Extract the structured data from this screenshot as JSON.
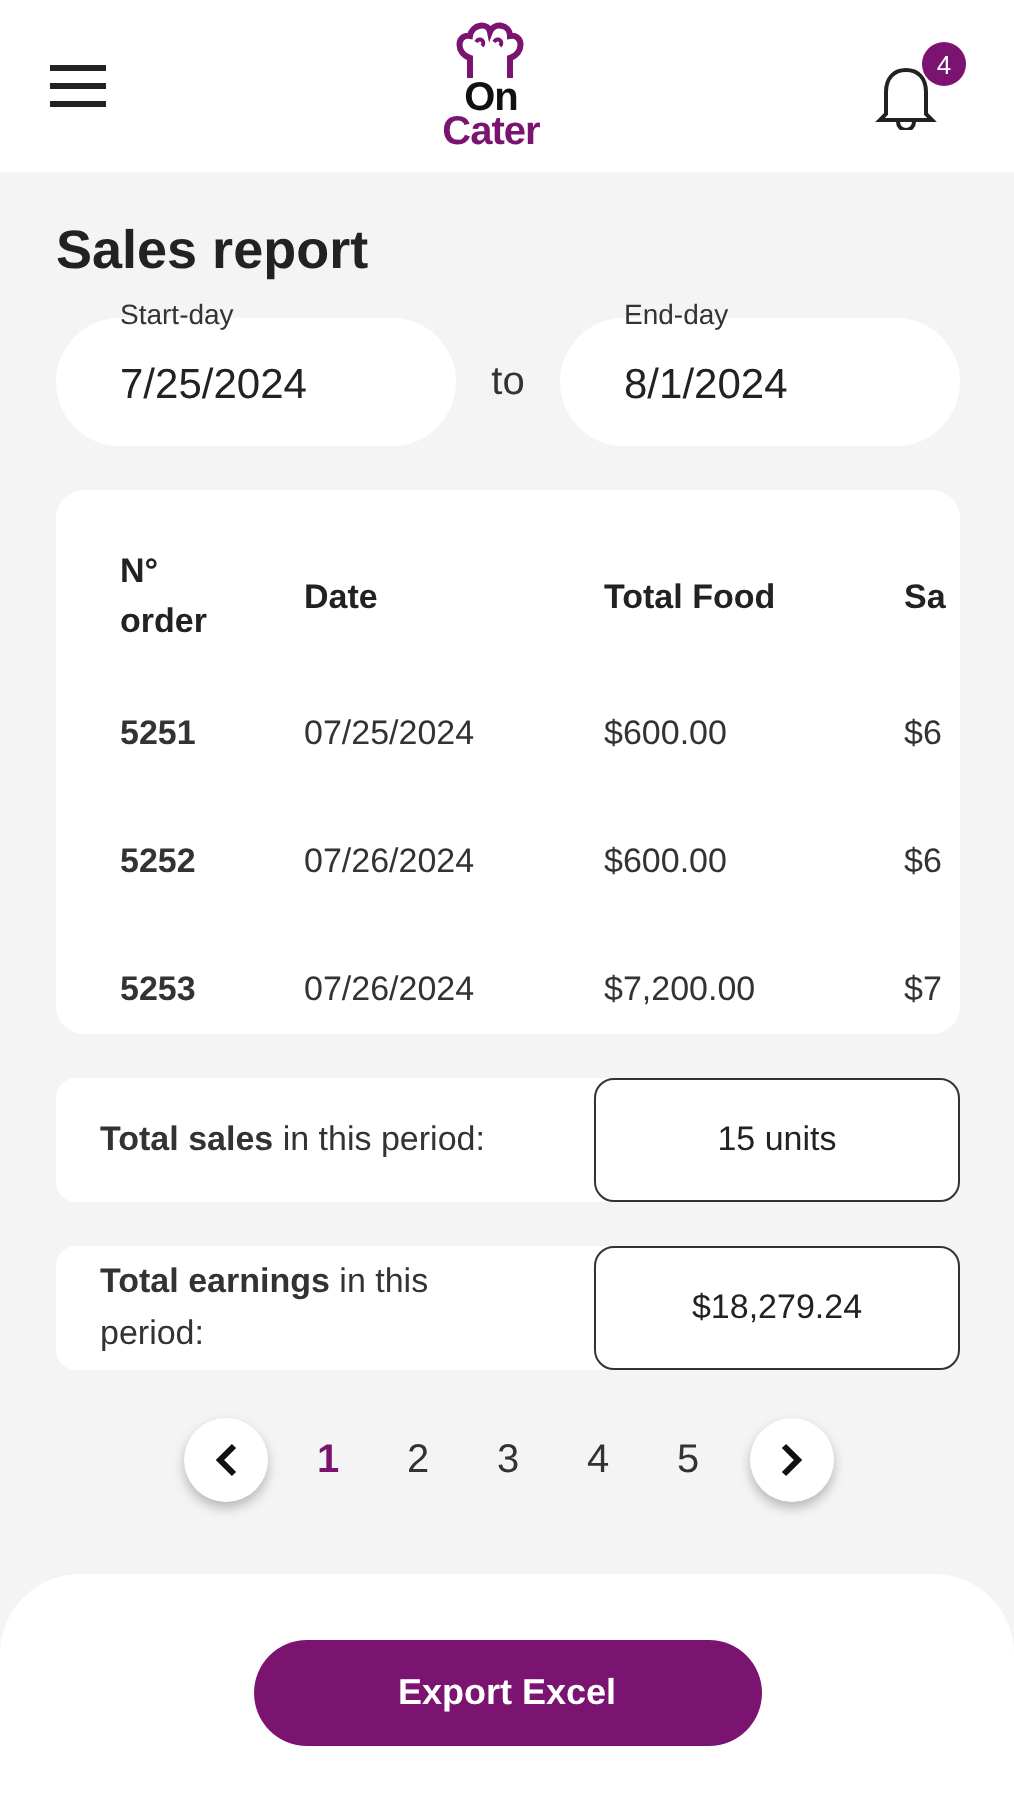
{
  "header": {
    "logo": {
      "line_1": "On",
      "line_2": "Cater"
    },
    "notifications": {
      "count": "4"
    }
  },
  "title": "Sales report",
  "date_range": {
    "start": {
      "label": "Start-day",
      "value": "7/25/2024"
    },
    "separator": "to",
    "end": {
      "label": "End-day",
      "value": "8/1/2024"
    }
  },
  "table": {
    "columns": [
      "N° order",
      "Date",
      "Total Food",
      "Sa"
    ],
    "rows": [
      [
        "5251",
        "07/25/2024",
        "$600.00",
        "$6"
      ],
      [
        "5252",
        "07/26/2024",
        "$600.00",
        "$6"
      ],
      [
        "5253",
        "07/26/2024",
        "$7,200.00",
        "$7"
      ]
    ]
  },
  "summary": [
    {
      "label": "**Total sales** in this period:",
      "value": "15 units"
    },
    {
      "label": "**Total earnings** in this period:",
      "value": "$18,279.24"
    }
  ],
  "pagination": {
    "pages": [
      {
        "label": "1",
        "selected": true
      },
      {
        "label": "2",
        "selected": false
      },
      {
        "label": "3",
        "selected": false
      },
      {
        "label": "4",
        "selected": false
      },
      {
        "label": "5",
        "selected": false
      }
    ]
  },
  "export_button": "Export Excel"
}
